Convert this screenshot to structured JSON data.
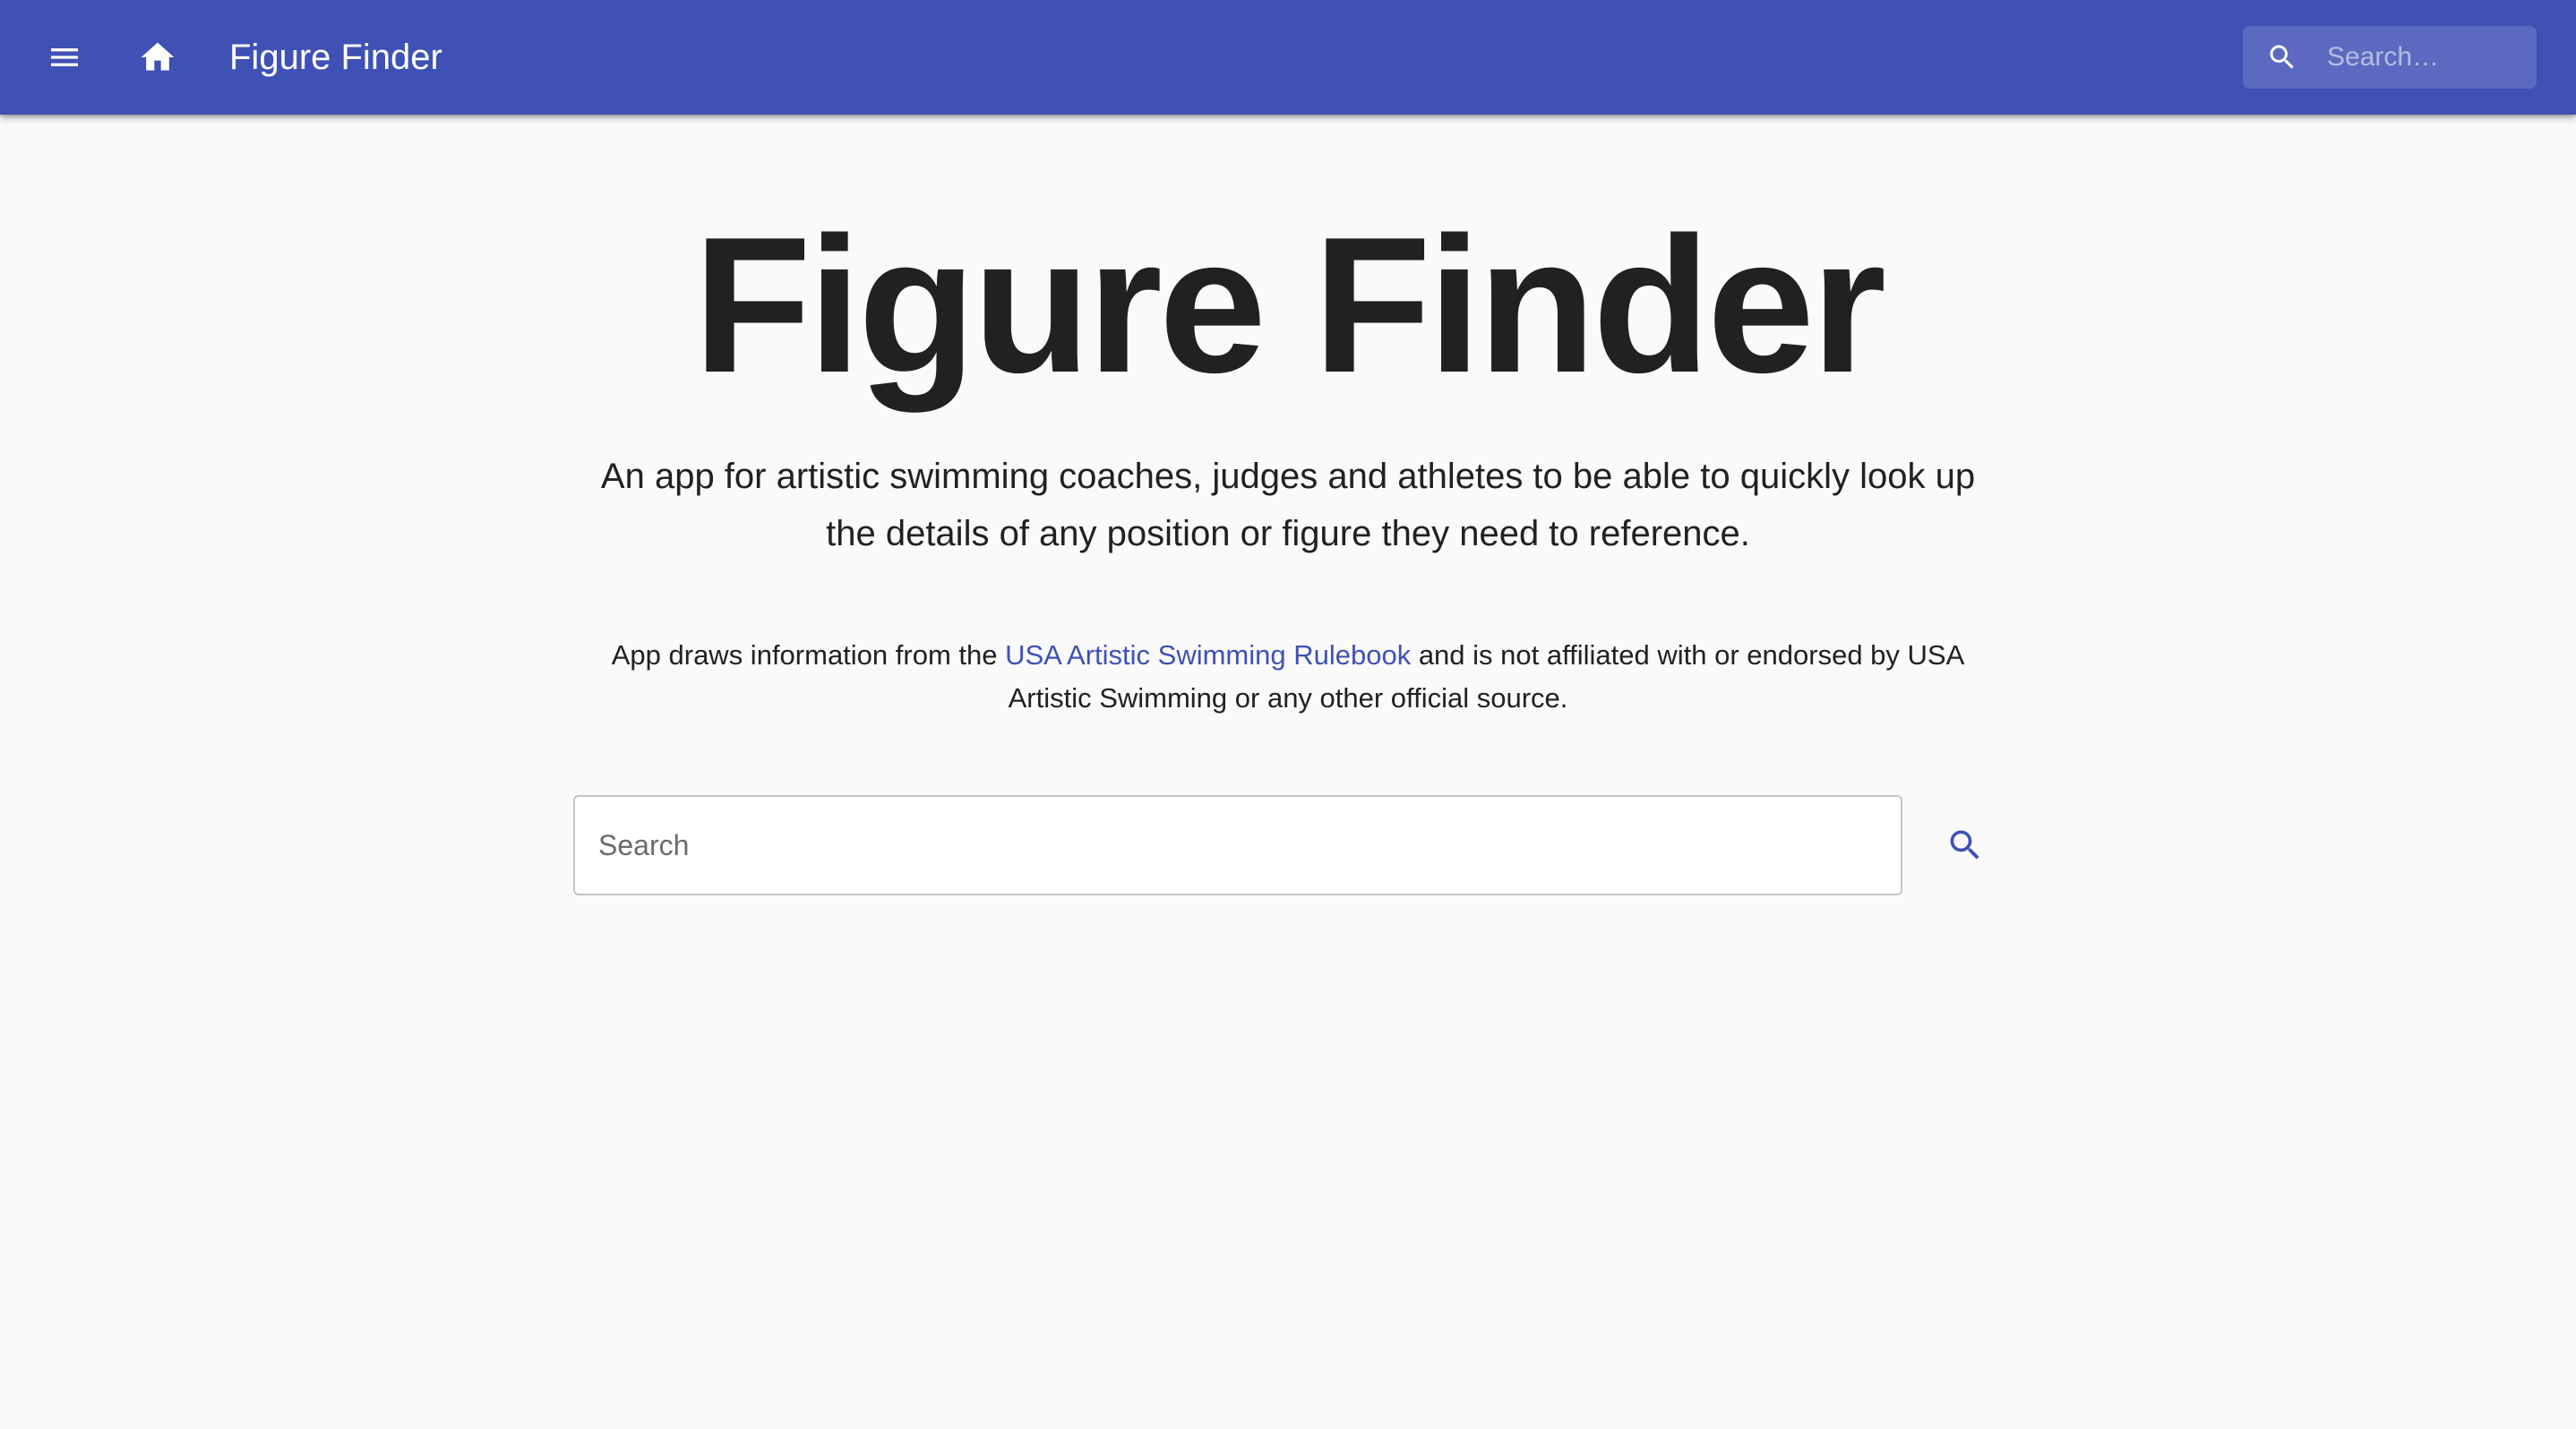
{
  "appbar": {
    "title": "Figure Finder",
    "menu_icon": "menu-icon",
    "home_icon": "home-icon",
    "search": {
      "placeholder": "Search…",
      "icon": "search-icon"
    }
  },
  "main": {
    "title": "Figure Finder",
    "tagline": "An app for artistic swimming coaches, judges and athletes to be able to quickly look up the details of any position or figure they need to reference.",
    "disclaimer": {
      "prefix": "App draws information from the ",
      "link_text": "USA Artistic Swimming Rulebook",
      "suffix": " and is not affiliated with or endorsed by USA Artistic Swimming or any other official source."
    },
    "search": {
      "placeholder": "Search",
      "value": "",
      "button_icon": "search-icon"
    }
  },
  "colors": {
    "primary": "#3f51b5",
    "background": "#fafafa",
    "text": "#212121",
    "link": "#3f51b5"
  }
}
